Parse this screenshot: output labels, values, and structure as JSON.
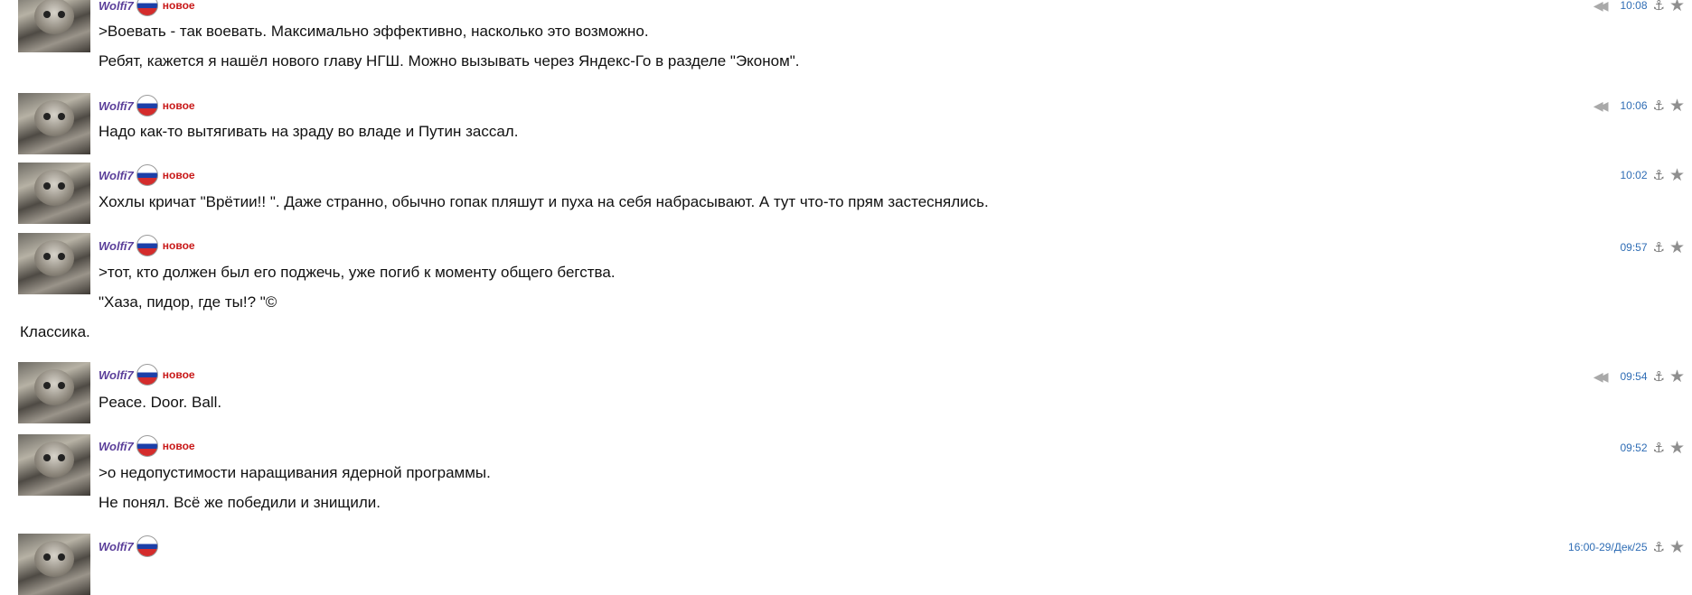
{
  "posts": [
    {
      "author": "Wolfi7",
      "badge": "новое",
      "time": "10:08",
      "lines": [
        ">Воевать - так воевать. Максимально эффективно, насколько это возможно.",
        "Ребят, кажется я нашёл нового главу НГШ. Можно вызывать через Яндекс-Го в разделе \"Эконом\"."
      ]
    },
    {
      "author": "Wolfi7",
      "badge": "новое",
      "time": "10:06",
      "lines": [
        "Надо как-то вытягивать на зраду во владе и Путин зассал."
      ]
    },
    {
      "author": "Wolfi7",
      "badge": "новое",
      "time": "10:02",
      "lines": [
        "Хохлы кричат \"Врётии!! \". Даже странно, обычно гопак пляшут и пуха на себя набрасывают. А тут что-то прям застеснялись."
      ]
    },
    {
      "author": "Wolfi7",
      "badge": "новое",
      "time": "09:57",
      "lines": [
        ">тот, кто должен был его поджечь, уже погиб к моменту общего бегства.",
        "\"Хаза, пидор, где ты!? \"©",
        "Классика."
      ]
    },
    {
      "author": "Wolfi7",
      "badge": "новое",
      "time": "09:54",
      "lines": [
        "Peace. Door. Ball."
      ]
    },
    {
      "author": "Wolfi7",
      "badge": "новое",
      "time": "09:52",
      "lines": [
        ">о недопустимости наращивания ядерной программы.",
        "Не понял. Всё же победили и знищили."
      ]
    },
    {
      "author": "Wolfi7",
      "badge": "",
      "time": "16:00-29/Дек/25",
      "lines": []
    }
  ],
  "icons": {
    "rewind": "rewind-icon",
    "anchor": "anchor-icon",
    "star": "star-icon"
  },
  "colors": {
    "author": "#5b3f9a",
    "new_badge": "#c81818",
    "time_link": "#2f6db5",
    "icon_gray": "#8f8f8f"
  }
}
